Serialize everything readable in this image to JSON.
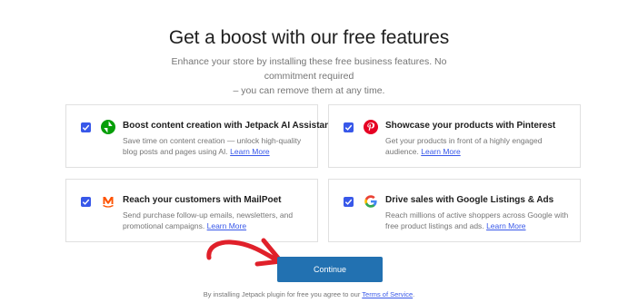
{
  "header": {
    "title": "Get a boost with our free features",
    "subtitle_line1": "Enhance your store by installing these free business features. No commitment required",
    "subtitle_line2": "– you can remove them at any time."
  },
  "features": [
    {
      "title": "Boost content creation with Jetpack AI Assistant",
      "description": "Save time on content creation — unlock high-quality blog posts and pages using AI.",
      "link": "Learn More",
      "checked": true,
      "icon": "jetpack-icon"
    },
    {
      "title": "Showcase your products with Pinterest",
      "description": "Get your products in front of a highly engaged audience.",
      "link": "Learn More",
      "checked": true,
      "icon": "pinterest-icon"
    },
    {
      "title": "Reach your customers with MailPoet",
      "description": "Send purchase follow-up emails, newsletters, and promotional campaigns.",
      "link": "Learn More",
      "checked": true,
      "icon": "mailpoet-icon"
    },
    {
      "title": "Drive sales with Google Listings & Ads",
      "description": "Reach millions of active shoppers across Google with free product listings and ads.",
      "link": "Learn More",
      "checked": true,
      "icon": "google-icon"
    }
  ],
  "actions": {
    "continue_label": "Continue"
  },
  "footer": {
    "text": "By installing Jetpack plugin for free you agree to our",
    "link": "Terms of Service",
    "end": "."
  },
  "colors": {
    "accent": "#3858e9",
    "button": "#2271b1",
    "arrow": "#e0202a"
  }
}
